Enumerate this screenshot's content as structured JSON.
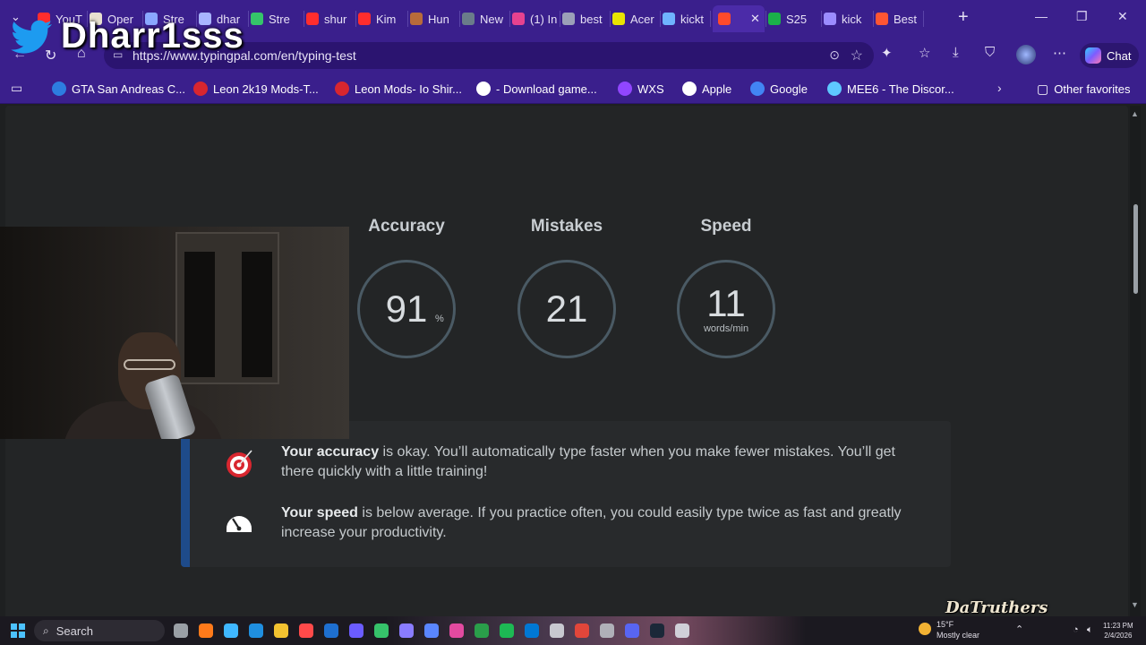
{
  "browser": {
    "tabs": [
      {
        "label": "YouT",
        "color": "#ff2d2d"
      },
      {
        "label": "Oper",
        "color": "#e8e0d0"
      },
      {
        "label": "Stre",
        "color": "#8aa7ff"
      },
      {
        "label": "dhar",
        "color": "#a8b4ff"
      },
      {
        "label": "Stre",
        "color": "#35c46a"
      },
      {
        "label": "shur",
        "color": "#ff2d2d"
      },
      {
        "label": "Kim",
        "color": "#ff2d2d"
      },
      {
        "label": "Hun",
        "color": "#b86b3a"
      },
      {
        "label": "New",
        "color": "#6a7c8a"
      },
      {
        "label": "(1) In",
        "color": "#e6428f"
      },
      {
        "label": "best",
        "color": "#9ba0b8"
      },
      {
        "label": "Acer",
        "color": "#e9e400"
      },
      {
        "label": "kickt",
        "color": "#6fb3ff"
      },
      {
        "label": "",
        "color": "#ff4a2a"
      },
      {
        "label": "S25",
        "color": "#1bb04a"
      },
      {
        "label": "kick",
        "color": "#9b8cff"
      },
      {
        "label": "Best",
        "color": "#ff5533"
      }
    ],
    "active_tab_close": "✕",
    "new_tab": "+",
    "window_controls": {
      "minimize": "—",
      "restore": "❐",
      "close": "✕"
    },
    "url": "https://www.typingpal.com/en/typing-test",
    "chat_label": "Chat",
    "favorites": [
      {
        "label": "GTA San Andreas C...",
        "color": "#2d7de0"
      },
      {
        "label": "Leon 2k19 Mods-T...",
        "color": "#d8262f"
      },
      {
        "label": "Leon Mods- Io Shir...",
        "color": "#d8262f"
      },
      {
        "label": "- Download game...",
        "color": "#ffffff"
      },
      {
        "label": "WXS",
        "color": "#9146ff"
      },
      {
        "label": "Apple",
        "color": "#ffffff"
      },
      {
        "label": "Google",
        "color": "#4285f4"
      },
      {
        "label": "MEE6 - The Discor...",
        "color": "#5ec8ff"
      }
    ],
    "other_favorites": "Other favorites"
  },
  "results": {
    "accuracy": {
      "label": "Accuracy",
      "value": "91",
      "unit": "%"
    },
    "mistakes": {
      "label": "Mistakes",
      "value": "21"
    },
    "speed": {
      "label": "Speed",
      "value": "11",
      "unit": "words/min"
    }
  },
  "feedback": {
    "accuracy": {
      "strong": "Your accuracy",
      "text": " is okay. You’ll automatically type faster when you make fewer mistakes. You’ll get there quickly with a little training!"
    },
    "speed": {
      "strong": "Your speed",
      "text": " is below average. If you practice often, you could easily type twice as fast and greatly increase your productivity."
    }
  },
  "overlay": {
    "streamer_name": "Dharr1sss",
    "watermark": "DaTruthers"
  },
  "taskbar": {
    "search_label": "Search",
    "weather_temp": "15°F",
    "weather_desc": "Mostly clear",
    "time": "11:23 PM",
    "date": "2/4/2026"
  },
  "colors": {
    "browser_chrome": "#3a1f8c",
    "page_bg": "#232526",
    "feedback_accent": "#1e4b8a",
    "ring_border": "#4a5a64"
  }
}
